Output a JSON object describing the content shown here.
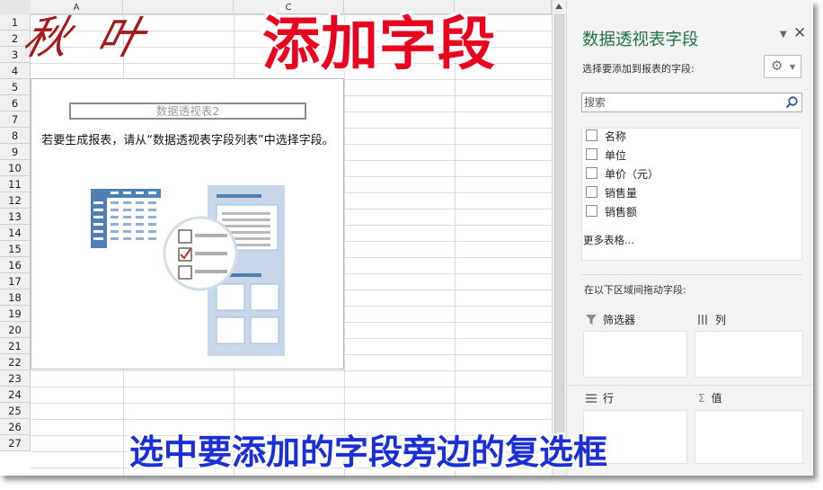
{
  "sheet": {
    "columns": [
      "A",
      "",
      "C",
      "",
      "",
      "",
      ""
    ],
    "rows": [
      "1",
      "2",
      "3",
      "4",
      "5",
      "6",
      "7",
      "8",
      "9",
      "10",
      "11",
      "12",
      "13",
      "14",
      "15",
      "16",
      "17",
      "18",
      "19",
      "20",
      "21",
      "22",
      "23",
      "24",
      "25",
      "26",
      "27"
    ]
  },
  "pivot": {
    "name": "数据透视表2",
    "hint": "若要生成报表，请从“数据透视表字段列表”中选择字段。"
  },
  "pane": {
    "title": "数据透视表字段",
    "subtitle": "选择要添加到报表的字段:",
    "search_placeholder": "搜索",
    "fields": [
      {
        "label": "名称"
      },
      {
        "label": "单位"
      },
      {
        "label": "单价（元）"
      },
      {
        "label": "销售量"
      },
      {
        "label": "销售额"
      }
    ],
    "more_tables": "更多表格...",
    "drag_hint": "在以下区域间拖动字段:",
    "areas": {
      "filters": "筛选器",
      "columns": "列",
      "rows": "行",
      "values": "值"
    }
  },
  "icons": {
    "settings": "gear-icon",
    "search": "magnifier-icon",
    "filter": "funnel-icon",
    "columns": "columns-icon",
    "rows": "rows-icon",
    "values": "sigma-icon"
  },
  "overlay": {
    "logo": "秋 叶",
    "title": "添加字段",
    "caption": "选中要添加的字段旁边的复选框"
  },
  "colors": {
    "accent": "#217346",
    "title_red": "#e8001e",
    "caption_blue": "#1a2fd6",
    "illustration_blue": "#4e7fb5"
  }
}
